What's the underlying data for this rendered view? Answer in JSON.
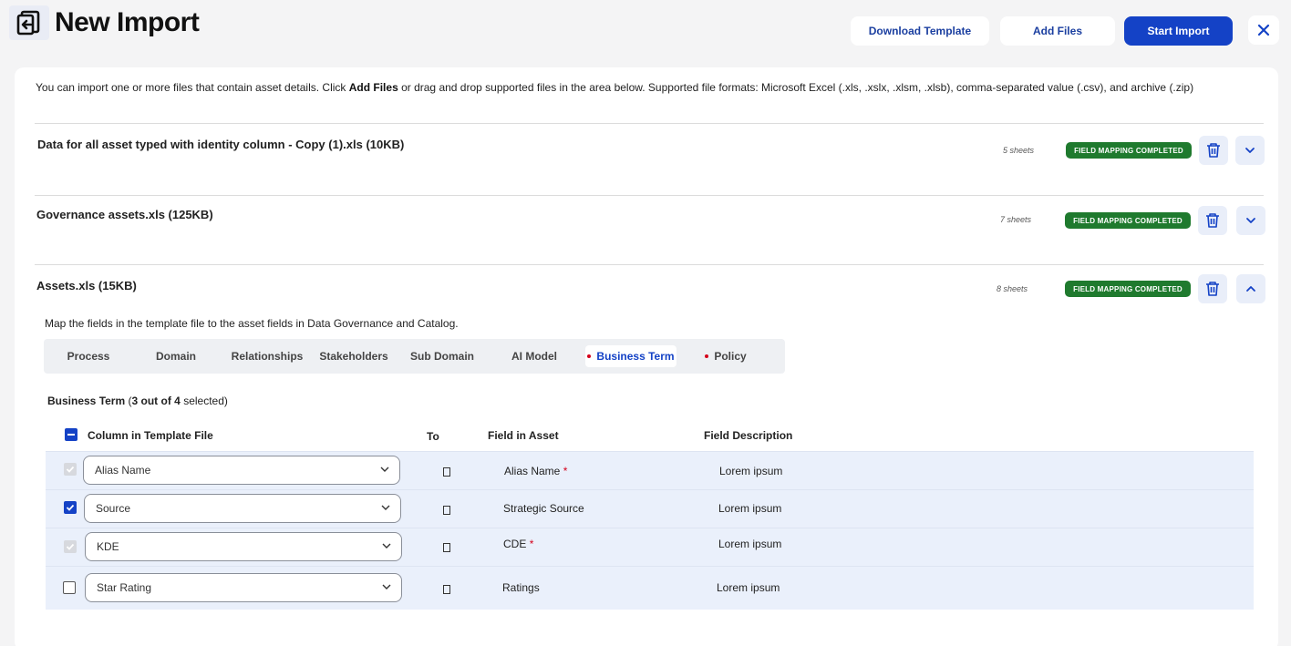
{
  "header": {
    "title": "New Import",
    "download_template": "Download Template",
    "add_files": "Add Files",
    "start_import": "Start Import"
  },
  "intro": {
    "part1": "You can import one or more files that contain asset details. Click ",
    "bold": "Add Files",
    "part2": " or drag and drop supported files in the area below. Supported file formats: Microsoft Excel (.xls, .xslx, .xlsm, .xlsb), comma-separated value (.csv), and archive (.zip)"
  },
  "files": [
    {
      "name": "Data for all asset typed with identity column - Copy (1).xls (10KB)",
      "sheets": "5 sheets",
      "status": "FIELD MAPPING COMPLETED",
      "expanded": false
    },
    {
      "name": "Governance assets.xls (125KB)",
      "sheets": "7 sheets",
      "status": "FIELD MAPPING COMPLETED",
      "expanded": false
    },
    {
      "name": "Assets.xls (15KB)",
      "sheets": "8 sheets",
      "status": "FIELD MAPPING COMPLETED",
      "expanded": true
    }
  ],
  "mapping": {
    "instruction": "Map the fields in the template file to the asset fields in Data Governance and Catalog.",
    "tabs": [
      {
        "label": "Process",
        "flag": false,
        "active": false
      },
      {
        "label": "Domain",
        "flag": false,
        "active": false
      },
      {
        "label": "Relationships",
        "flag": false,
        "active": false
      },
      {
        "label": "Stakeholders",
        "flag": false,
        "active": false
      },
      {
        "label": "Sub Domain",
        "flag": false,
        "active": false
      },
      {
        "label": "AI Model",
        "flag": false,
        "active": false
      },
      {
        "label": "Business Term",
        "flag": true,
        "active": true
      },
      {
        "label": "Policy",
        "flag": true,
        "active": false
      }
    ],
    "section_name": "Business Term",
    "selected_count": "3 out of 4",
    "selected_suffix": "selected)",
    "columns": {
      "template": "Column in Template File",
      "to": "To",
      "field": "Field in Asset",
      "description": "Field Description"
    },
    "rows": [
      {
        "checkbox": "disabled-checked",
        "template_value": "Alias Name",
        "field": "Alias Name",
        "required": true,
        "description": "Lorem ipsum"
      },
      {
        "checkbox": "checked",
        "template_value": "Source",
        "field": "Strategic Source",
        "required": false,
        "description": "Lorem ipsum"
      },
      {
        "checkbox": "disabled-checked",
        "template_value": "KDE",
        "field": "CDE",
        "required": true,
        "description": "Lorem ipsum"
      },
      {
        "checkbox": "unchecked",
        "template_value": "Star Rating",
        "field": "Ratings",
        "required": false,
        "description": "Lorem ipsum"
      }
    ],
    "required_mark": "*"
  },
  "colors": {
    "primary": "#1442c6",
    "success": "#1f7a2e",
    "required": "#d4001a",
    "row_bg": "#eaf0fb"
  },
  "icons": [
    "import-icon",
    "close-icon",
    "trash-icon",
    "chevron-down-icon",
    "chevron-up-icon"
  ]
}
